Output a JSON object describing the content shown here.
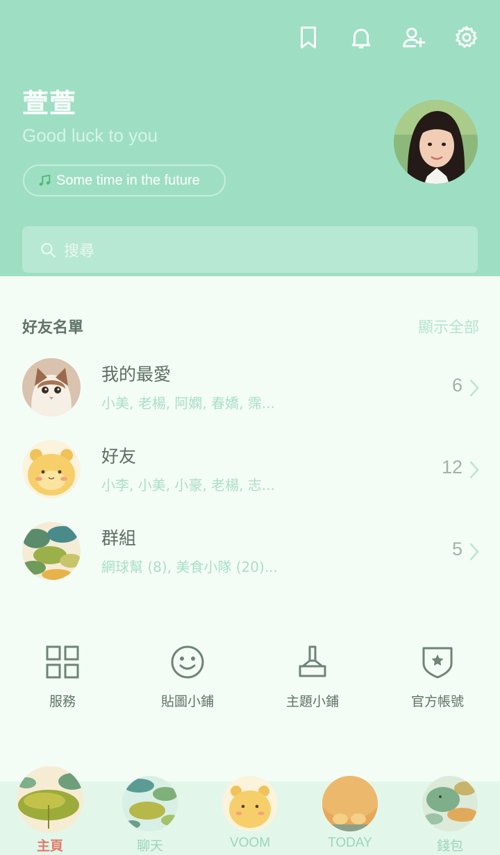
{
  "header": {
    "user_name": "萱萱",
    "status_message": "Good luck to you",
    "music": "Some time in the future",
    "icons": [
      "bookmark-icon",
      "bell-icon",
      "add-friend-icon",
      "gear-icon"
    ],
    "background_color": "#9edfc4"
  },
  "search": {
    "placeholder": "搜尋"
  },
  "friends": {
    "title": "好友名單",
    "show_all": "顯示全部",
    "rows": [
      {
        "title": "我的最愛",
        "subtitle": "小美, 老楊, 阿嫻, 春嬌, 霈...",
        "count": "6"
      },
      {
        "title": "好友",
        "subtitle": "小李, 小美, 小豪, 老楊, 志...",
        "count": "12"
      },
      {
        "title": "群組",
        "subtitle": "網球幫 (8), 美食小隊 (20)...",
        "count": "5"
      }
    ]
  },
  "shortcuts": [
    {
      "label": "服務",
      "icon": "grid-icon"
    },
    {
      "label": "貼圖小鋪",
      "icon": "smiley-icon"
    },
    {
      "label": "主題小鋪",
      "icon": "brush-icon"
    },
    {
      "label": "官方帳號",
      "icon": "shield-star-icon"
    }
  ],
  "bottom_nav": [
    {
      "label": "主頁",
      "active": true
    },
    {
      "label": "聊天",
      "active": false
    },
    {
      "label": "VOOM",
      "active": false
    },
    {
      "label": "TODAY",
      "active": false
    },
    {
      "label": "錢包",
      "active": false
    }
  ],
  "colors": {
    "accent": "#9edfc4",
    "active_tab": "#e07a6a",
    "subtitle": "#a9dfc6"
  }
}
